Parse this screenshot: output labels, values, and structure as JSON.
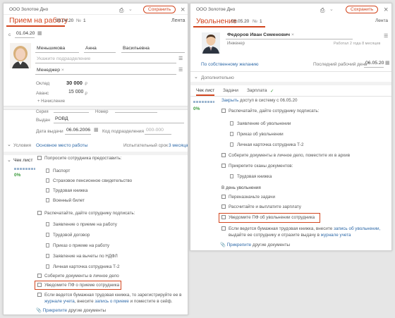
{
  "colors": {
    "accent": "#d2451e",
    "link": "#2f6aa8"
  },
  "left": {
    "org": "ООО Золотое Дно",
    "title": "Прием на работу",
    "date": "08.04.20",
    "num": "№",
    "num_val": "1",
    "save": "Сохранить",
    "feed": "Лента",
    "date_prefix": "с",
    "start_date": "01.04.20",
    "lastname": "Меньшикова",
    "firstname": "Анна",
    "middlename": "Васильевна",
    "dept_placeholder": "Укажите подразделение",
    "position": "Менеджер",
    "salary_label": "Оклад",
    "salary": "30 000",
    "advance_label": "Аванс",
    "advance": "15 000",
    "currency": "₽",
    "accruals": "+ Начисление",
    "series_label": "Серия",
    "number_label": "Номер",
    "issued_label": "Выдан",
    "issued": "РОВД",
    "issue_date_label": "Дата выдачи",
    "issue_date": "06.06.2006",
    "dept_code_label": "Код подразделения",
    "dept_code": "000-000",
    "conditions": "Условия",
    "main_place": "Основное место работы",
    "probation": "Испытательный срок",
    "probation_val": "3 месяца",
    "checklist": "Чек лист",
    "percent": "0%",
    "ask_provide": "Попросите сотрудника предоставить:",
    "docs_provide": [
      "Паспорт",
      "Страховое пенсионное свидетельство",
      "Трудовая книжка",
      "Военный билет"
    ],
    "print_sign": "Распечатайте, дайте сотруднику подписать:",
    "docs_sign": [
      "Заявление о приеме на работу",
      "Трудовой договор",
      "Приказ о приеме на работу",
      "Заявление на вычеты по НДФЛ",
      "Личная карточка сотрудника Т-2"
    ],
    "collect_docs": "Соберите документы в личное дело",
    "notify_pf": "Уведомите ПФ о приеме сотрудника",
    "paper_book_1": "Если ведется бумажная трудовая книжка, то зарегистрируйте ее в",
    "paper_book_2a": "журнале учета",
    "paper_book_2b": ", внесите",
    "paper_book_2c": "запись о приеме",
    "paper_book_2d": "и поместите в сейф.",
    "attach": "Прикрепите",
    "attach_rest": "другие документы"
  },
  "right": {
    "org": "ООО Золотое Дно",
    "title": "Увольнение",
    "date": "06.05.20",
    "num": "№",
    "num_val": "1",
    "save": "Сохранить",
    "feed": "Лента",
    "name": "Федоров Иван Семенович",
    "position": "Инженер",
    "work_info": "Работал 2 года 8 месяцев",
    "reason": "По собственному желанию",
    "last_day_label": "Последний рабочий день",
    "last_day": "06.05.20",
    "extra": "Дополнительно",
    "tabs": [
      "Чек лист",
      "Задачи",
      "Зарплата"
    ],
    "percent": "0%",
    "close_access_1": "Закрыть",
    "close_access_2": "доступ в систему с 06.05.20",
    "print_sign": "Распечатайте, дайте сотруднику подписать:",
    "docs_sign": [
      "Заявление об увольнении",
      "Приказ об увольнении",
      "Личная карточка сотрудника Т-2"
    ],
    "collect_docs": "Соберите документы в личное дело, поместите их в архив",
    "attach_scans": "Прикрепите сканы документов:",
    "scan_doc": "Трудовая книжка",
    "on_day": "В день увольнения",
    "reassign": "Переназначьте задачи",
    "pay_salary": "Рассчитайте и выплатите зарплату",
    "notify_pf": "Уведомите ПФ об увольнении сотрудника",
    "paper_1a": "Если ведется бумажная трудовая книжка, внесите",
    "paper_1b": "запись об увольнении,",
    "paper_2a": "выдайте ее сотруднику и отразите выдачу в",
    "paper_2b": "журнале учета",
    "attach": "Прикрепите",
    "attach_rest": "другие документы"
  }
}
